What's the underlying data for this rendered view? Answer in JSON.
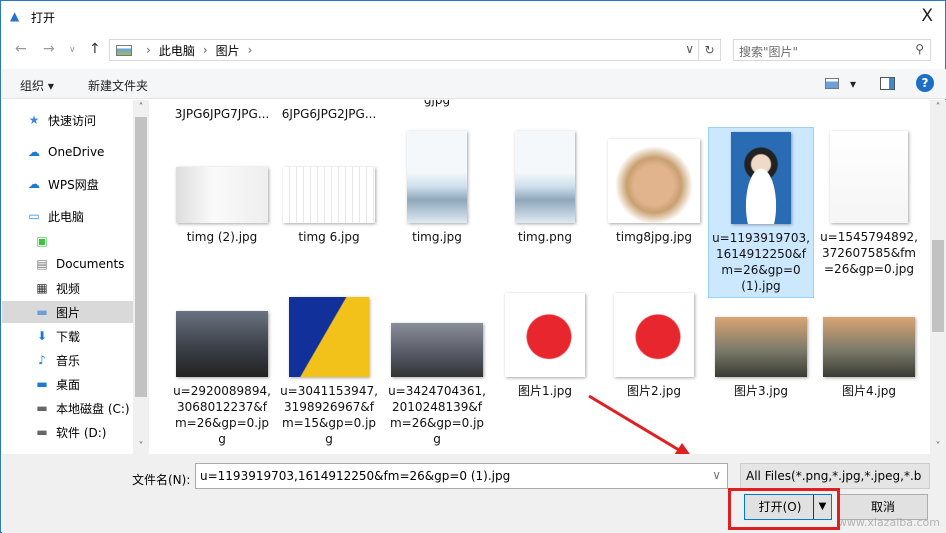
{
  "window": {
    "title": "打开",
    "close": "X"
  },
  "nav": {
    "back": "←",
    "forward": "→",
    "recent": "∨",
    "up": "↑"
  },
  "address": {
    "crumbs": [
      "此电脑",
      "图片"
    ],
    "refresh": "↻",
    "dropdown": "∨"
  },
  "search": {
    "placeholder": "搜索\"图片\""
  },
  "toolbar": {
    "organize": "组织 ▾",
    "new_folder": "新建文件夹",
    "view": "▾",
    "help": "?"
  },
  "sidebar": {
    "items": [
      {
        "label": "快速访问",
        "icon": "star-icon"
      },
      {
        "label": "OneDrive",
        "icon": "cloud-icon"
      },
      {
        "label": "WPS网盘",
        "icon": "cloud-icon"
      },
      {
        "label": "此电脑",
        "icon": "computer-icon"
      },
      {
        "label": "",
        "icon": "app-icon"
      },
      {
        "label": "Documents",
        "icon": "document-icon"
      },
      {
        "label": "视频",
        "icon": "video-icon"
      },
      {
        "label": "图片",
        "icon": "picture-icon"
      },
      {
        "label": "下载",
        "icon": "download-icon"
      },
      {
        "label": "音乐",
        "icon": "music-icon"
      },
      {
        "label": "桌面",
        "icon": "desktop-icon"
      },
      {
        "label": "本地磁盘 (C:)",
        "icon": "drive-icon"
      },
      {
        "label": "软件 (D:)",
        "icon": "drive-icon"
      }
    ]
  },
  "files": {
    "row0": [
      "3JPG6JPG7JPG...",
      "6JPG6JPG2JPG...",
      "gjpg"
    ],
    "items": [
      {
        "name": "timg (2).jpg"
      },
      {
        "name": "timg 6.jpg"
      },
      {
        "name": "timg.jpg"
      },
      {
        "name": "timg.png"
      },
      {
        "name": "timg8jpg.jpg"
      },
      {
        "name": "u=1193919703,1614912250&fm=26&gp=0 (1).jpg",
        "selected": true
      },
      {
        "name": "u=1545794892,372607585&fm=26&gp=0.jpg"
      },
      {
        "name": "u=2920089894,3068012237&fm=26&gp=0.jpg"
      },
      {
        "name": "u=3041153947,3198926967&fm=15&gp=0.jpg"
      },
      {
        "name": "u=3424704361,2010248139&fm=26&gp=0.jpg"
      },
      {
        "name": "图片1.jpg"
      },
      {
        "name": "图片2.jpg"
      },
      {
        "name": "图片3.jpg"
      },
      {
        "name": "图片4.jpg"
      }
    ]
  },
  "bottom": {
    "filename_label": "文件名(N):",
    "filename_value": "u=1193919703,1614912250&fm=26&gp=0 (1).jpg",
    "filetype": "All Files(*.png,*.jpg,*.jpeg,*.b",
    "open": "打开(O)",
    "cancel": "取消"
  },
  "watermark": "www.xiazaiba.com"
}
